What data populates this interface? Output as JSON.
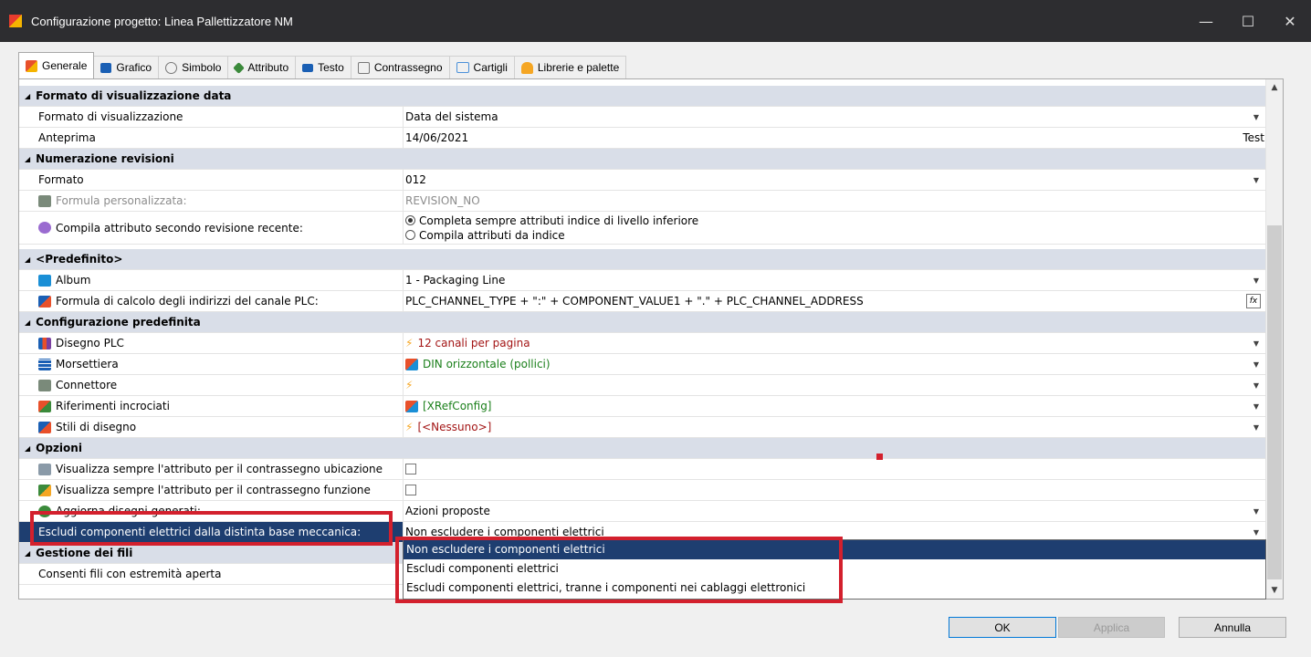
{
  "window": {
    "title": "Configurazione progetto: Linea Pallettizzatore NM",
    "controls": {
      "minimize": "—",
      "maximize": "☐",
      "close": "✕"
    }
  },
  "tabs": [
    {
      "label": "Generale",
      "icon": "generale-icon",
      "color": "#e8502a"
    },
    {
      "label": "Grafico",
      "icon": "grafico-icon",
      "color": "#1a5fb4"
    },
    {
      "label": "Simbolo",
      "icon": "simbolo-icon",
      "color": "#777777"
    },
    {
      "label": "Attributo",
      "icon": "attributo-icon",
      "color": "#3b8a3b"
    },
    {
      "label": "Testo",
      "icon": "testo-icon",
      "color": "#1a5fb4"
    },
    {
      "label": "Contrassegno",
      "icon": "contrassegno-icon",
      "color": "#777777"
    },
    {
      "label": "Cartigli",
      "icon": "cartigli-icon",
      "color": "#4a90d9"
    },
    {
      "label": "Librerie e palette",
      "icon": "librerie-icon",
      "color": "#f5a623"
    }
  ],
  "grid": {
    "cat_formato_data": "Formato di visualizzazione data",
    "formato_vis_label": "Formato di visualizzazione",
    "formato_vis_value": "Data del sistema",
    "anteprima_label": "Anteprima",
    "anteprima_value": "14/06/2021",
    "anteprima_test": "Test",
    "cat_numerazione": "Numerazione revisioni",
    "formato_label": "Formato",
    "formato_value": "012",
    "formula_pers_label": "Formula personalizzata:",
    "formula_pers_value": "REVISION_NO",
    "compila_label": "Compila attributo secondo revisione recente:",
    "compila_option1": "Completa sempre attributi indice di livello inferiore",
    "compila_option2": "Compila attributi da indice",
    "cat_predefinito": "<Predefinito>",
    "album_label": "Album",
    "album_value": "1 - Packaging Line",
    "plc_formula_label": "Formula di calcolo degli indirizzi del canale PLC:",
    "plc_formula_value": "PLC_CHANNEL_TYPE + \":\" + COMPONENT_VALUE1 + \".\" + PLC_CHANNEL_ADDRESS",
    "fx_label": "fx",
    "cat_config_predef": "Configurazione predefinita",
    "disegno_plc_label": "Disegno PLC",
    "disegno_plc_value": "12 canali per pagina",
    "morsettiera_label": "Morsettiera",
    "morsettiera_value": "DIN orizzontale (pollici)",
    "connettore_label": "Connettore",
    "rif_incr_label": "Riferimenti incrociati",
    "rif_incr_value": "[XRefConfig]",
    "stili_label": "Stili di disegno",
    "stili_value": "[<Nessuno>]",
    "cat_opzioni": "Opzioni",
    "vis_ubicazione_label": "Visualizza sempre l'attributo per il contrassegno ubicazione",
    "vis_funzione_label": "Visualizza sempre l'attributo per il contrassegno funzione",
    "aggiorna_label": "Aggiorna disegni generati:",
    "aggiorna_value": "Azioni proposte",
    "escludi_label": "Escludi componenti elettrici dalla distinta base meccanica:",
    "escludi_value": "Non escludere i componenti elettrici",
    "cat_gestione_fili": "Gestione dei fili",
    "consenti_fili_label": "Consenti fili con estremità aperta"
  },
  "dropdown": {
    "options": [
      "Non escludere i componenti elettrici",
      "Escludi componenti elettrici",
      "Escludi componenti elettrici, tranne i componenti nei cablaggi elettronici"
    ],
    "selected": "Non escludere i componenti elettrici"
  },
  "buttons": {
    "ok": "OK",
    "apply": "Applica",
    "cancel": "Annulla"
  },
  "colors": {
    "category_bg": "#d9dee8",
    "selection": "#1e3e70",
    "highlight": "#d3202d",
    "green_value": "#1a7f1a",
    "red_value": "#a31515"
  }
}
